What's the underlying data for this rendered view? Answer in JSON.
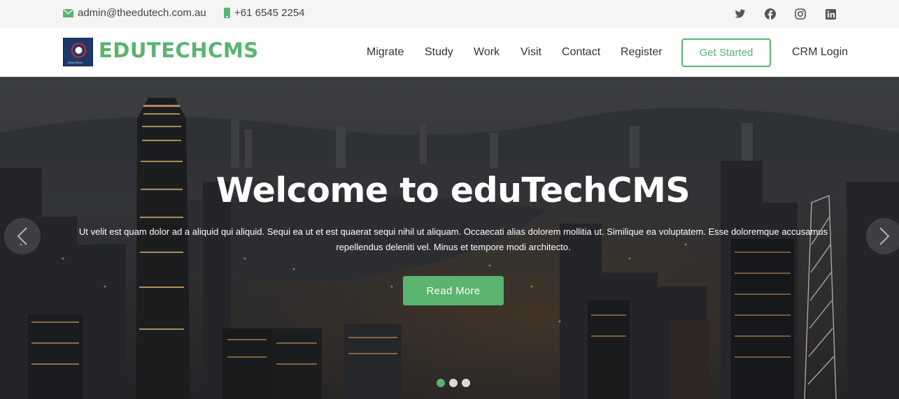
{
  "topbar": {
    "email": "admin@theedutech.com.au",
    "phone": "+61 6545 2254",
    "social": [
      "twitter-icon",
      "facebook-icon",
      "instagram-icon",
      "linkedin-icon"
    ]
  },
  "header": {
    "logo_text": "EDUTECHCMS",
    "logo_caption": "EDUTECH",
    "nav": [
      "Migrate",
      "Study",
      "Work",
      "Visit",
      "Contact",
      "Register"
    ],
    "cta_label": "Get Started",
    "crm_label": "CRM Login"
  },
  "hero": {
    "title": "Welcome to eduTechCMS",
    "text": "Ut velit est quam dolor ad a aliquid qui aliquid. Sequi ea ut et est quaerat sequi nihil ut aliquam. Occaecati alias dolorem mollitia ut. Similique ea voluptatem. Esse doloremque accusamus repellendus deleniti vel. Minus et tempore modi architecto.",
    "button_label": "Read More",
    "slides_count": 3,
    "active_slide": 1
  },
  "colors": {
    "accent": "#5ab470",
    "topbar_bg": "#f5f5f5",
    "hero_overlay": "#3e4246"
  }
}
